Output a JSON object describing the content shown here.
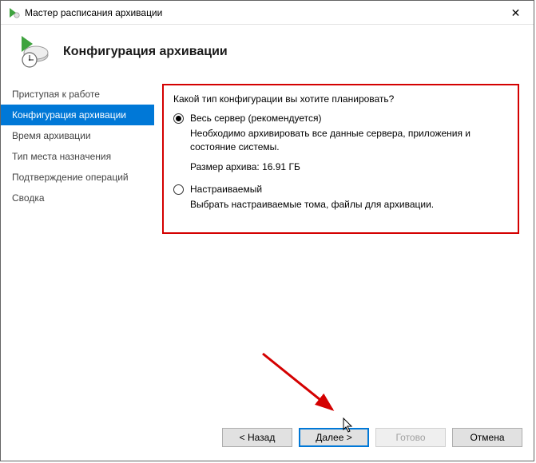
{
  "window": {
    "title": "Мастер расписания архивации"
  },
  "header": {
    "title": "Конфигурация архивации"
  },
  "sidebar": {
    "items": [
      {
        "label": "Приступая к работе"
      },
      {
        "label": "Конфигурация архивации"
      },
      {
        "label": "Время архивации"
      },
      {
        "label": "Тип места назначения"
      },
      {
        "label": "Подтверждение операций"
      },
      {
        "label": "Сводка"
      }
    ],
    "active_index": 1
  },
  "content": {
    "prompt": "Какой тип конфигурации вы хотите планировать?",
    "option_full": {
      "label": "Весь сервер (рекомендуется)",
      "description": "Необходимо архивировать все данные сервера, приложения и состояние системы.",
      "size_line": "Размер архива: 16.91 ГБ",
      "selected": true
    },
    "option_custom": {
      "label": "Настраиваемый",
      "description": "Выбрать настраиваемые тома, файлы для архивации.",
      "selected": false
    }
  },
  "footer": {
    "back": "< Назад",
    "next": "Далее >",
    "finish": "Готово",
    "cancel": "Отмена"
  }
}
